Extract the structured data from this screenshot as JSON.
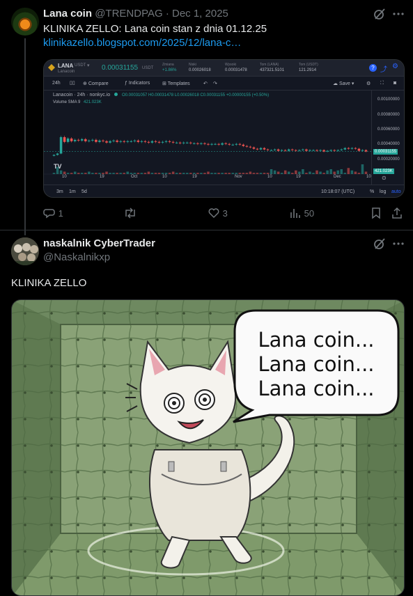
{
  "post": {
    "author_name": "Lana coin",
    "handle": "@TRENDPAG",
    "separator": "·",
    "date": "Dec 1, 2025",
    "text": "KLINIKA ZELLO: Lana coin stan z dnia 01.12.25",
    "link": "klinikazello.blogspot.com/2025/12/lana-c…",
    "actions": {
      "replies": "1",
      "reposts": "",
      "likes": "3",
      "views": "50"
    }
  },
  "tv": {
    "symbol": "LANA",
    "pair_suffix": "USDT",
    "base_name": "Lanacoin",
    "quote": "USDT",
    "price": "0.00031155",
    "stats": [
      {
        "label": "Zmiana",
        "value": "+1.86%"
      },
      {
        "label": "Niski",
        "value": "0.00026018"
      },
      {
        "label": "Wysoki",
        "value": "0.00031478"
      },
      {
        "label": "Tom (LANA)",
        "value": "437321.5101"
      },
      {
        "label": "Tom (USDT)",
        "value": "121.2914"
      }
    ],
    "toolbar": {
      "interval": "24h",
      "compare": "Compare",
      "indicators": "Indicators",
      "templates": "Templates",
      "save": "Save"
    },
    "legend_title": "Lanacoin · 24h · nonkyc.io",
    "ohlc": "O0.00031057 H0.00031478 L0.00026018 C0.00031155 +0.00000155 (+0.50%)",
    "volume_label": "Volume SMA 9",
    "volume_value": "421.023K",
    "price_badge": "0.00031155",
    "volume_badge": "421.023K",
    "time": "10:18:07 (UTC)",
    "ranges": [
      "3m",
      "1m",
      "5d"
    ],
    "pct_label": "%",
    "log_label": "log",
    "auto_label": "auto",
    "logo": "TV"
  },
  "chart_data": {
    "type": "candlestick",
    "title": "Lanacoin · 24h · nonkyc.io",
    "y_ticks": [
      "0.00100000",
      "0.00080000",
      "0.00060000",
      "0.00040000",
      "0.00020000"
    ],
    "x_ticks": [
      "10",
      "19",
      "Oct",
      "10",
      "19",
      "Nov",
      "10",
      "19",
      "Dec",
      "10"
    ],
    "close_series": [
      0.00026,
      0.00028,
      0.00052,
      0.00045,
      0.0005,
      0.00046,
      0.00048,
      0.00047,
      0.00049,
      0.00046,
      0.00047,
      0.00048,
      0.00045,
      0.00047,
      0.00046,
      0.00044,
      0.00046,
      0.00047,
      0.00045,
      0.00046,
      0.00045,
      0.00046,
      0.00046,
      0.00047,
      0.00045,
      0.00046,
      0.00045,
      0.00044,
      0.00046,
      0.00045,
      0.00044,
      0.00045,
      0.00046,
      0.00045,
      0.00044,
      0.00044,
      0.00043,
      0.00044,
      0.00044,
      0.00043,
      0.00043,
      0.00042,
      0.00043,
      0.00042,
      0.00041,
      0.00042,
      0.00042,
      0.00041,
      0.00043,
      0.00042,
      0.00041,
      0.00041,
      0.00042,
      0.00041,
      0.00039,
      0.00038,
      0.00037,
      0.00035,
      0.00034,
      0.00036,
      0.00034,
      0.00033,
      0.00033,
      0.00034,
      0.00032,
      0.00033,
      0.00032,
      0.00034,
      0.00033,
      0.00032,
      0.00033,
      0.00034,
      0.00032,
      0.00033,
      0.00033,
      0.00032,
      0.00033,
      0.00031,
      0.00032,
      0.00033,
      0.00032,
      0.00033,
      0.00034,
      0.00036,
      0.00035,
      0.00036,
      0.00035,
      0.00032,
      0.00033,
      0.00031
    ],
    "volume_series": [
      1,
      6,
      3,
      2,
      1,
      1,
      2,
      1,
      1,
      1,
      2,
      1,
      1,
      1,
      1,
      2,
      1,
      1,
      1,
      1,
      1,
      2,
      1,
      1,
      1,
      1,
      1,
      2,
      1,
      1,
      1,
      1,
      1,
      1,
      2,
      1,
      1,
      1,
      1,
      1,
      1,
      1,
      1,
      1,
      2,
      1,
      1,
      1,
      1,
      1,
      1,
      1,
      1,
      1,
      1,
      1,
      2,
      1,
      1,
      1,
      1,
      1,
      4,
      3,
      2,
      1,
      3,
      2,
      1,
      3,
      2,
      4,
      1,
      2,
      1,
      3,
      2,
      1,
      3,
      4,
      2,
      3,
      4,
      1,
      5,
      3,
      2,
      1,
      8,
      2
    ]
  },
  "reply": {
    "author_name": "naskalnik CyberTrader",
    "handle": "@Naskalnikxp",
    "text": "KLINIKA ZELLO",
    "bubble_lines": [
      "Lana coin...",
      "Lana coin...",
      "Lana coin..."
    ]
  },
  "colors": {
    "link": "#1d9bf0",
    "up": "#26a69a",
    "down": "#ef5350",
    "muted": "#71767b"
  }
}
